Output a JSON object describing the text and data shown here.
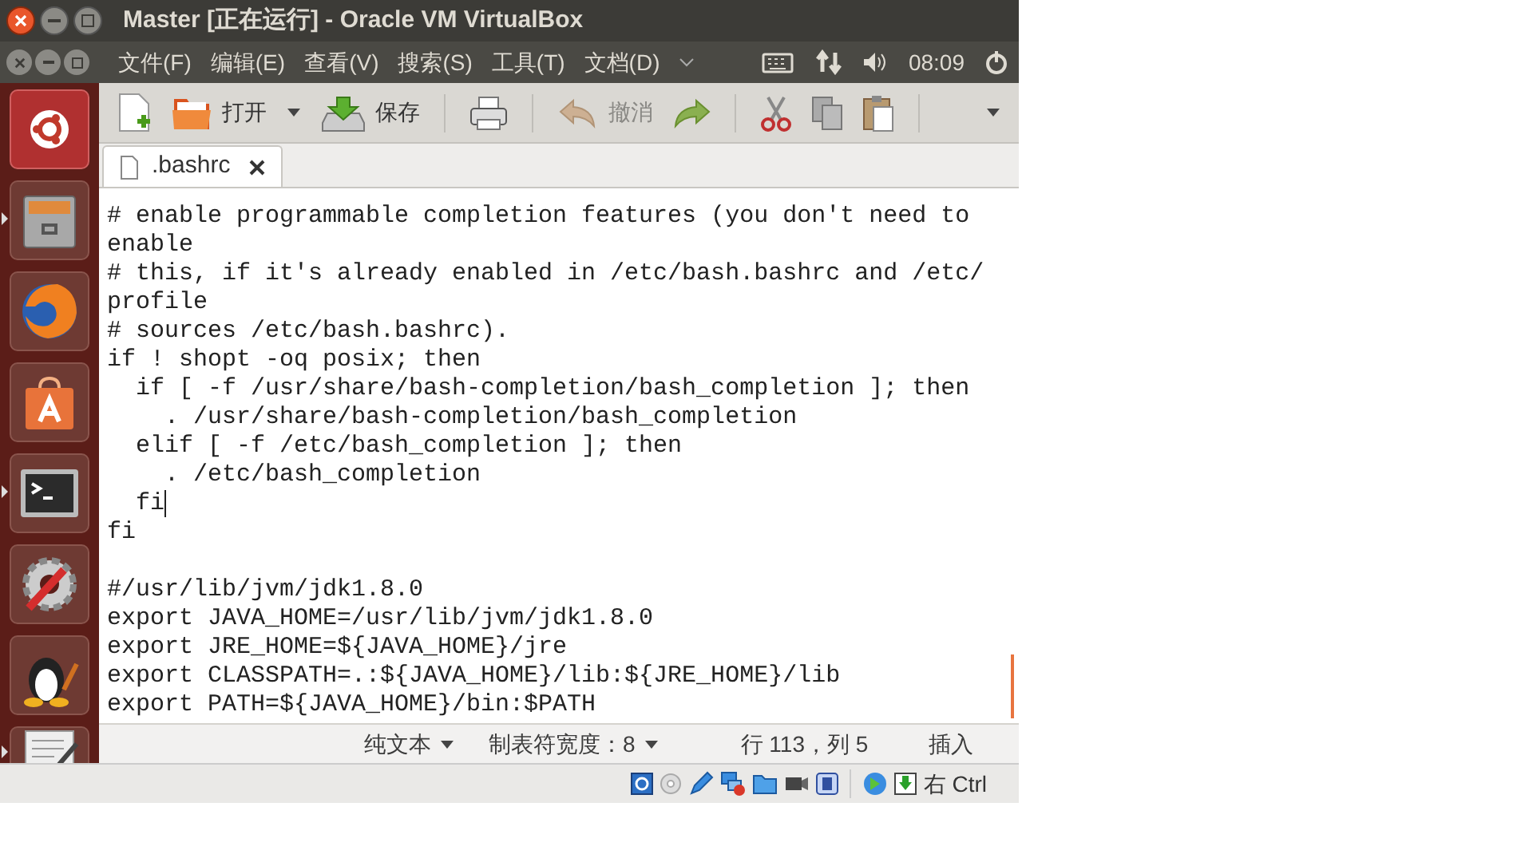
{
  "window": {
    "title": "Master [正在运行] - Oracle VM VirtualBox"
  },
  "menu_bar": {
    "items": [
      "文件(F)",
      "编辑(E)",
      "查看(V)",
      "搜索(S)",
      "工具(T)",
      "文档(D)"
    ],
    "clock": "08:09"
  },
  "launcher": [
    {
      "kind": "dash",
      "running": false
    },
    {
      "kind": "files",
      "running": true
    },
    {
      "kind": "browser",
      "running": false
    },
    {
      "kind": "store",
      "running": false
    },
    {
      "kind": "terminal",
      "running": true
    },
    {
      "kind": "settings",
      "running": false
    },
    {
      "kind": "penguin",
      "running": false
    },
    {
      "kind": "editor",
      "running": true
    }
  ],
  "toolbar": [
    {
      "kind": "new"
    },
    {
      "kind": "open",
      "label": "打开"
    },
    {
      "kind": "dropdown"
    },
    {
      "kind": "save",
      "label": "保存"
    },
    {
      "kind": "print"
    },
    {
      "kind": "undo",
      "label": "撤消",
      "disabled": true
    },
    {
      "kind": "redo"
    },
    {
      "kind": "cut"
    },
    {
      "kind": "copy"
    },
    {
      "kind": "paste"
    },
    {
      "kind": "more"
    }
  ],
  "tabs": [
    {
      "label": ".bashrc",
      "selected": true
    }
  ],
  "editor": {
    "lines": [
      {
        "text": "# enable programmable completion features (you don't need to",
        "cursor": false
      },
      {
        "text": "enable",
        "cursor": false
      },
      {
        "text": "# this, if it's already enabled in /etc/bash.bashrc and /etc/",
        "cursor": false
      },
      {
        "text": "profile",
        "cursor": false
      },
      {
        "text": "# sources /etc/bash.bashrc).",
        "cursor": false
      },
      {
        "text": "if ! shopt -oq posix; then",
        "cursor": false
      },
      {
        "text": "  if [ -f /usr/share/bash-completion/bash_completion ]; then",
        "cursor": false
      },
      {
        "text": "    . /usr/share/bash-completion/bash_completion",
        "cursor": false
      },
      {
        "text": "  elif [ -f /etc/bash_completion ]; then",
        "cursor": false
      },
      {
        "text": "    . /etc/bash_completion",
        "cursor": false
      },
      {
        "text": "  fi",
        "cursor": true
      },
      {
        "text": "fi",
        "cursor": false
      },
      {
        "cursor": false
      },
      {
        "text": "#/usr/lib/jvm/jdk1.8.0",
        "cursor": false
      },
      {
        "text": "export JAVA_HOME=/usr/lib/jvm/jdk1.8.0",
        "cursor": false
      },
      {
        "text": "export JRE_HOME=${JAVA_HOME}/jre",
        "cursor": false
      },
      {
        "text": "export CLASSPATH=.:${JAVA_HOME}/lib:${JRE_HOME}/lib",
        "cursor": false
      },
      {
        "text": "export PATH=${JAVA_HOME}/bin:$PATH",
        "cursor": false
      }
    ]
  },
  "status_bar": {
    "language": "纯文本",
    "tab_width": "制表符宽度：8",
    "position": "行 113，列 5",
    "mode": "插入"
  },
  "vm_status_bar": {
    "host_key": "右 Ctrl"
  }
}
